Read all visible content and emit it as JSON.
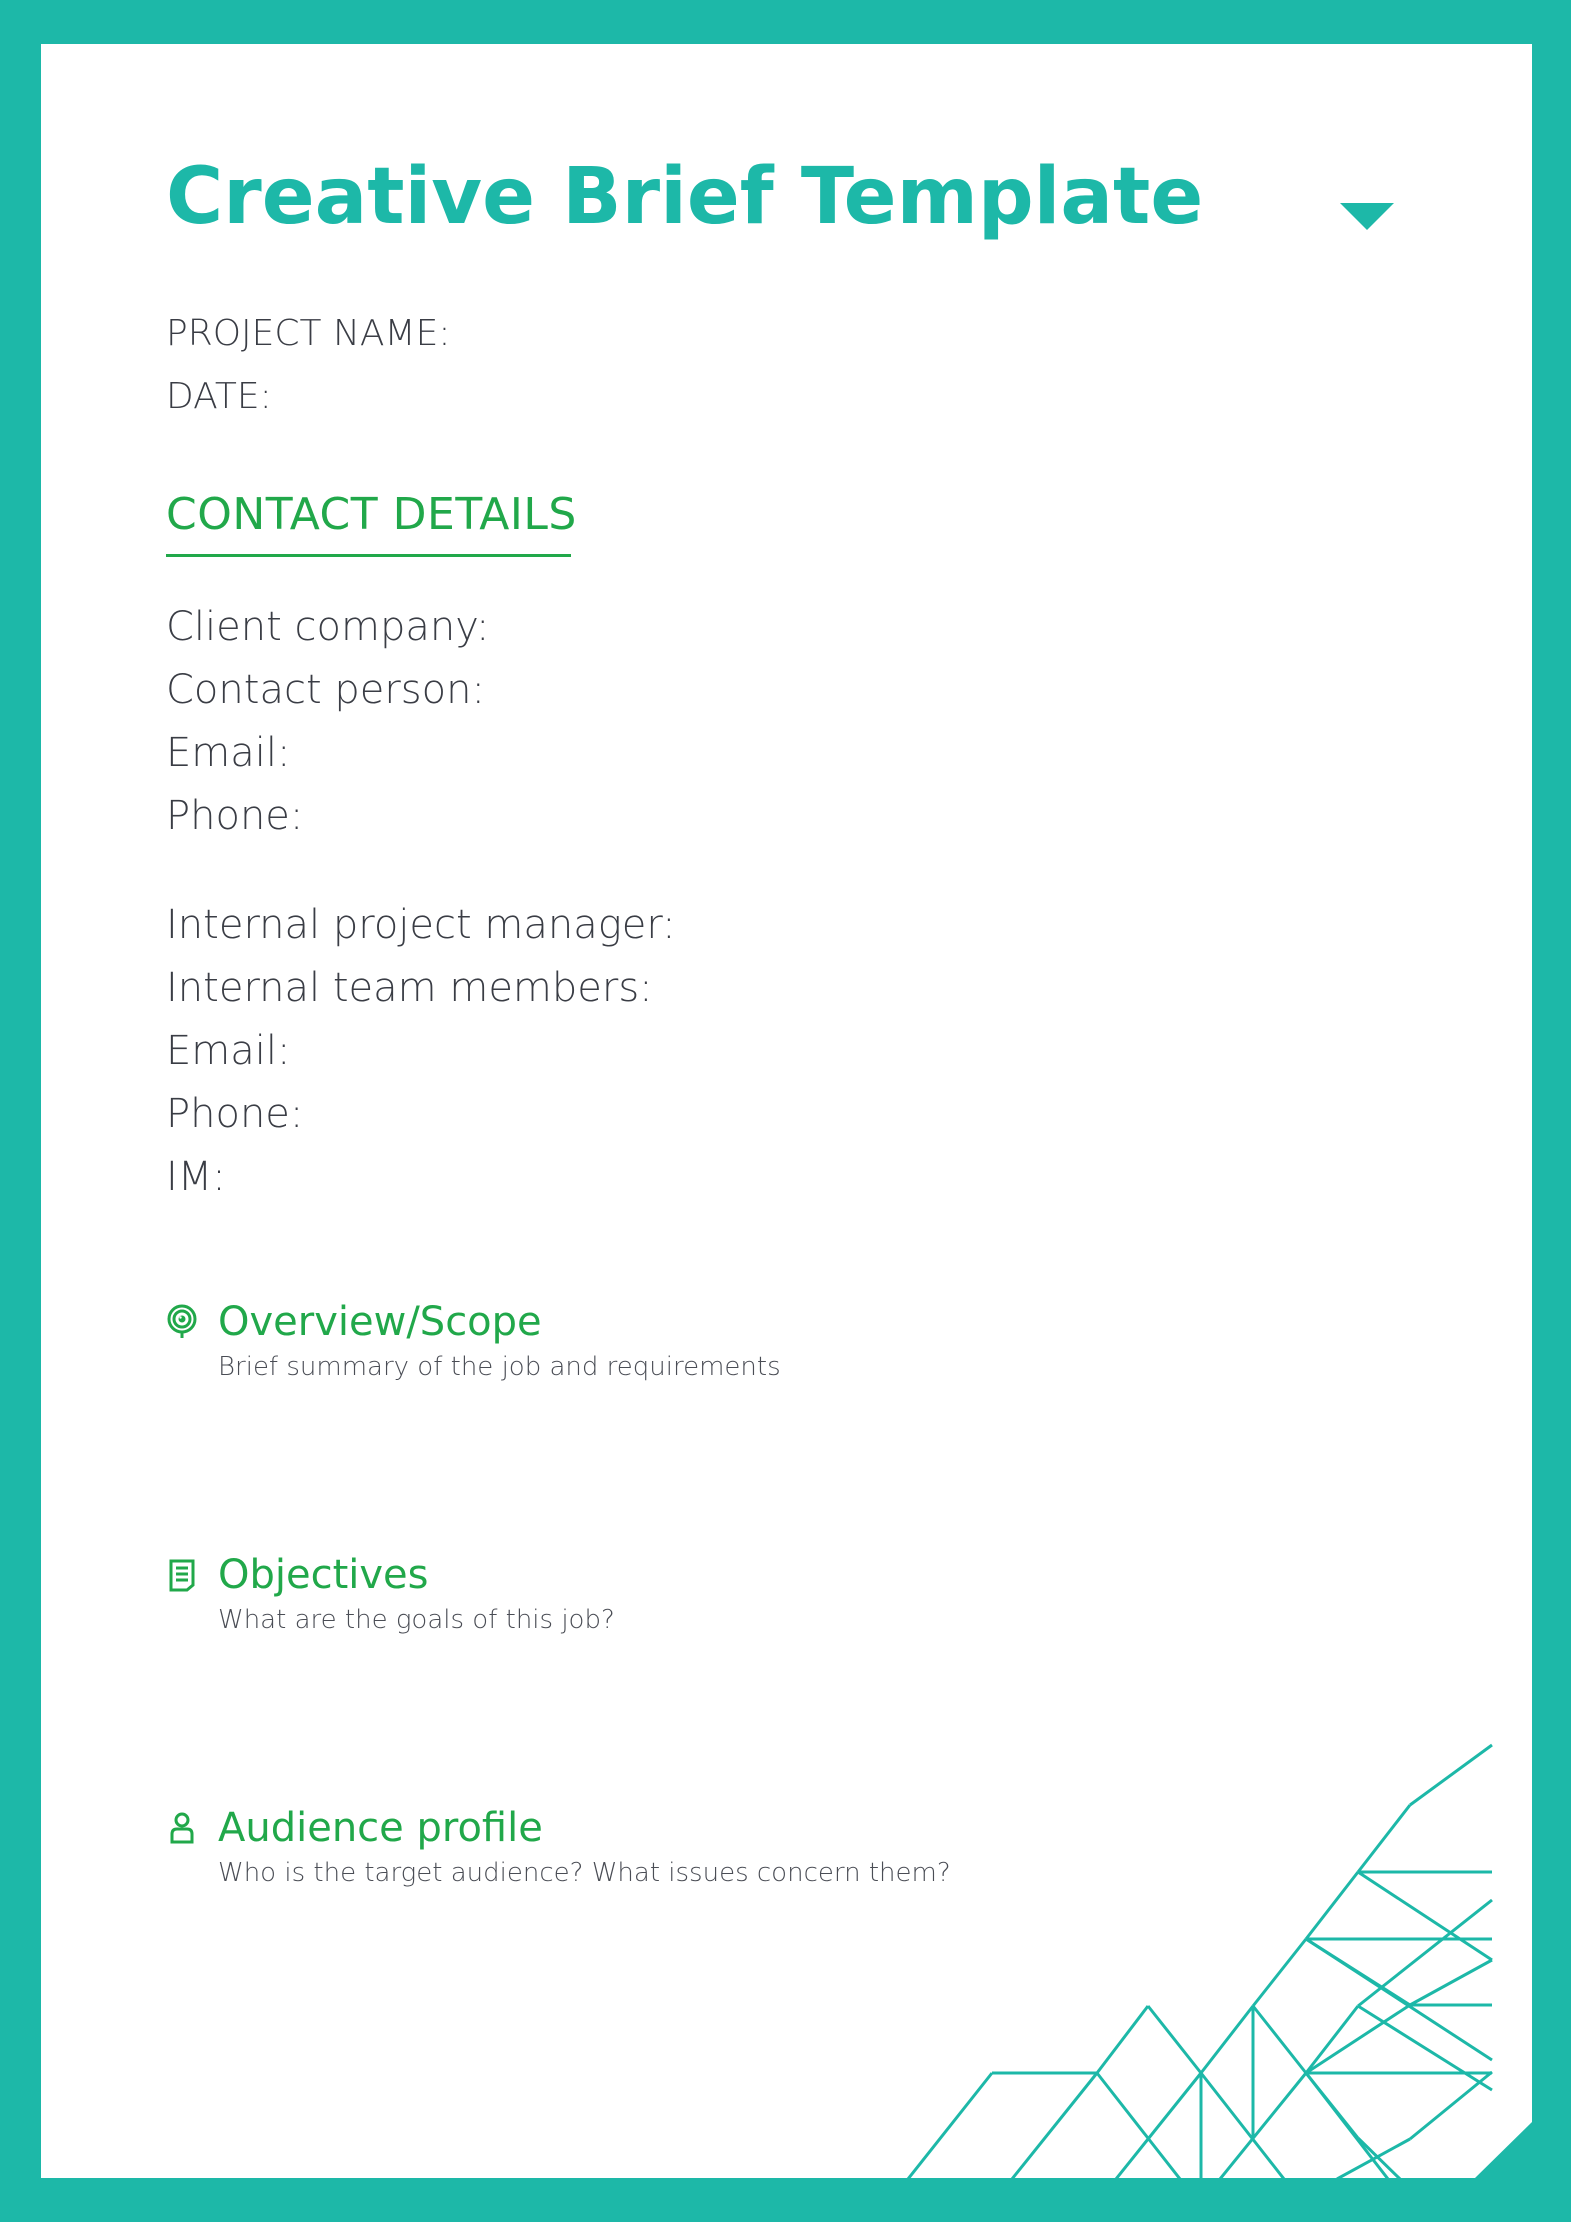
{
  "header": {
    "title": "Creative Brief Template",
    "toggle_icon": "triangle-down-icon"
  },
  "meta": {
    "project_name_label": "PROJECT NAME:",
    "date_label": "DATE:"
  },
  "contact_details": {
    "heading": "CONTACT DETAILS",
    "client_fields": [
      "Client company:",
      "Contact person:",
      "Email:",
      "Phone:"
    ],
    "internal_fields": [
      "Internal project manager:",
      "Internal team members:",
      "Email:",
      "Phone:",
      "IM:"
    ]
  },
  "sections": [
    {
      "icon": "target-eye-icon",
      "title": "Overview/Scope",
      "description": "Brief summary of the job and requirements"
    },
    {
      "icon": "document-icon",
      "title": "Objectives",
      "description": "What are the goals of this job?"
    },
    {
      "icon": "person-icon",
      "title": "Audience profile",
      "description": "Who is the target audience? What issues concern them?"
    }
  ],
  "colors": {
    "frame": "#1db8a8",
    "title": "#1db8a8",
    "accent_green": "#21a84a",
    "body_text": "#3a3d45"
  }
}
